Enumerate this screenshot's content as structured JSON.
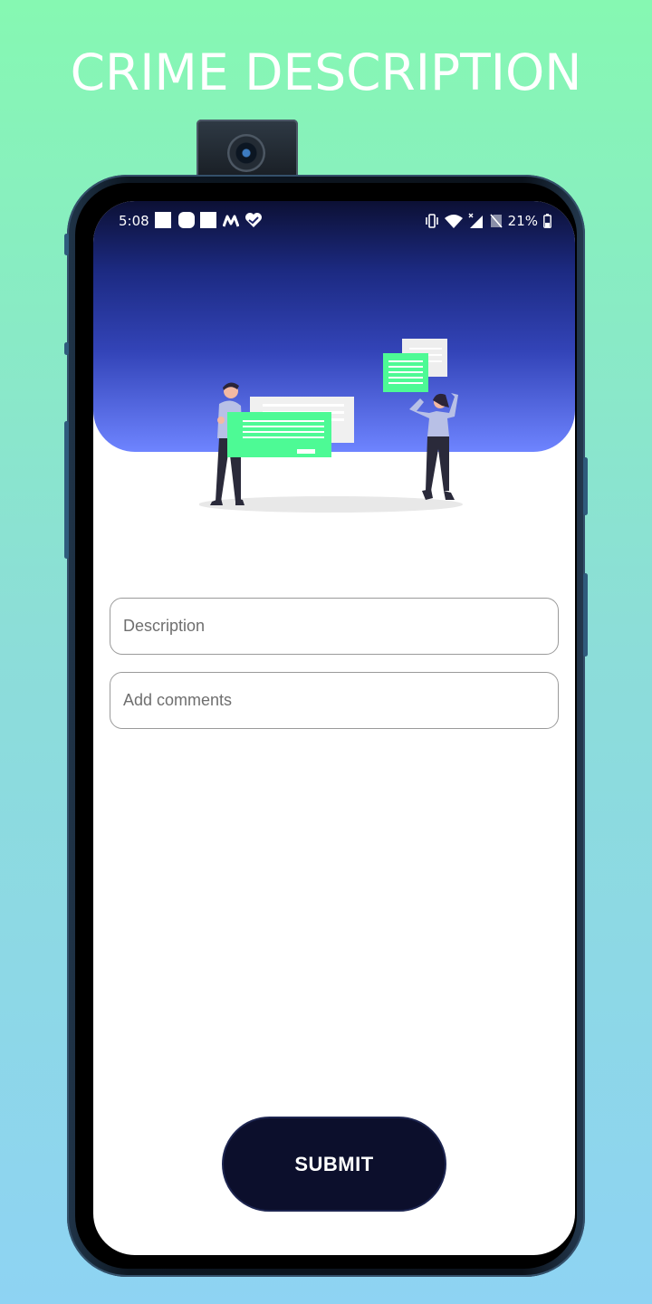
{
  "heading": "CRIME DESCRIPTION",
  "status_bar": {
    "time": "5:08",
    "battery_percent": "21%",
    "notification_icons": [
      "square-icon",
      "rounded-square-icon",
      "square-icon",
      "m-app-icon",
      "heart-check-icon"
    ],
    "system_icons": [
      "vibrate-icon",
      "wifi-icon",
      "signal-icon",
      "no-sim-icon",
      "battery-icon"
    ]
  },
  "form": {
    "description_placeholder": "Description",
    "description_value": "",
    "comments_placeholder": "Add comments",
    "comments_value": "",
    "submit_label": "SUBMIT"
  },
  "colors": {
    "accent_green": "#4dfa95",
    "header_dark": "#0c1034",
    "header_light": "#6e84ff",
    "button_bg": "#0c0f2c"
  }
}
